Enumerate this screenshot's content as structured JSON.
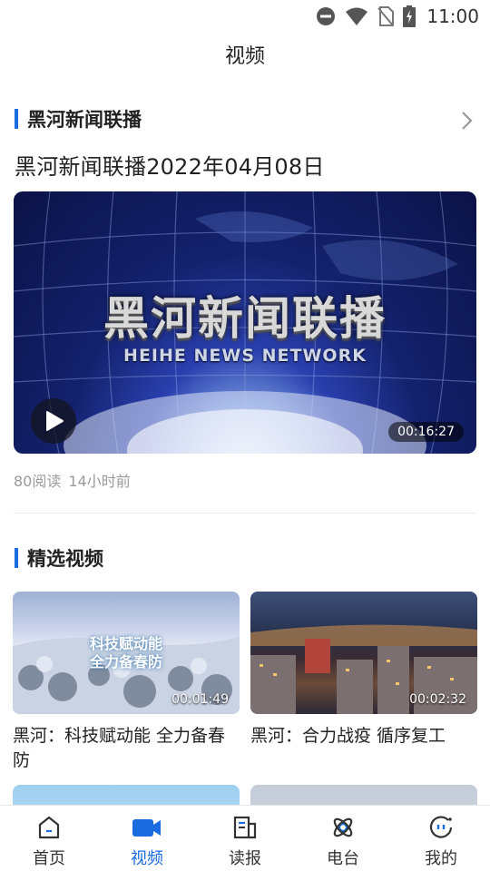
{
  "status_bar": {
    "time": "11:00"
  },
  "header": {
    "title": "视频"
  },
  "section_news": {
    "title": "黑河新闻联播",
    "headline": "黑河新闻联播2022年04月08日",
    "video": {
      "overlay_title": "黑河新闻联播",
      "overlay_subtitle": "HEIHE NEWS  NETWORK",
      "duration": "00:16:27"
    },
    "reads": "80阅读",
    "time_ago": "14小时前"
  },
  "section_featured": {
    "title": "精选视频",
    "items": [
      {
        "title": "黑河：科技赋动能 全力备春防",
        "duration": "00:01:49",
        "overlay_line1": "科技赋动能",
        "overlay_line2": "全力备春防"
      },
      {
        "title": "黑河：合力战疫 循序复工",
        "duration": "00:02:32"
      }
    ]
  },
  "bottom_nav": {
    "items": [
      {
        "label": "首页",
        "icon": "home-icon"
      },
      {
        "label": "视频",
        "icon": "video-camera-icon"
      },
      {
        "label": "读报",
        "icon": "newspaper-icon"
      },
      {
        "label": "电台",
        "icon": "radio-icon"
      },
      {
        "label": "我的",
        "icon": "profile-icon"
      }
    ],
    "active_index": 1
  },
  "colors": {
    "accent": "#1a6be0"
  }
}
